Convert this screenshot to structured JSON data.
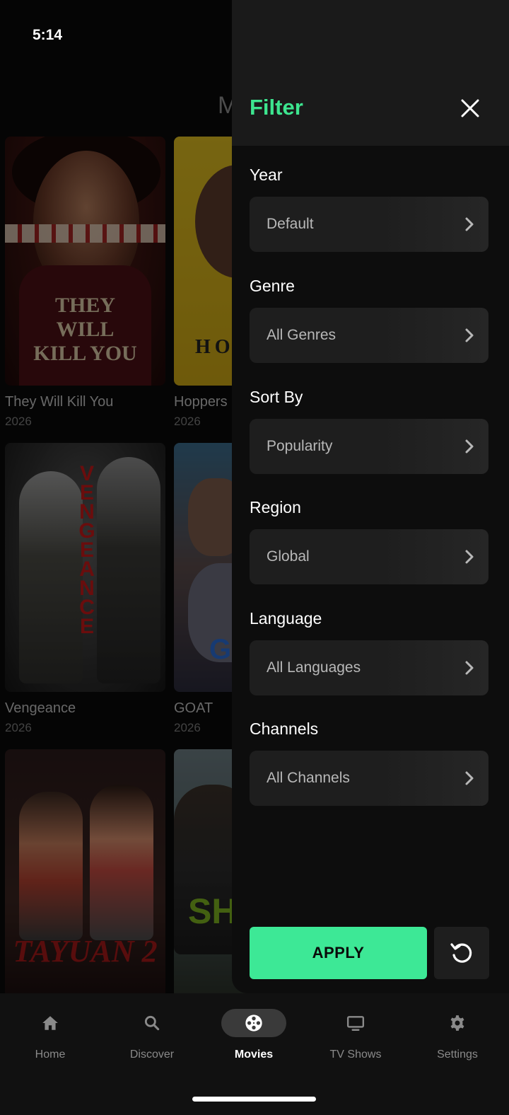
{
  "status_bar": {
    "time": "5:14"
  },
  "page": {
    "title": "M"
  },
  "movies": [
    {
      "title": "They Will Kill You",
      "year": "2026",
      "poster_text": "THEY WILL KILL YOU"
    },
    {
      "title": "Hoppers",
      "year": "2026",
      "poster_text": "HO"
    },
    {
      "title": "Vengeance",
      "year": "2026",
      "poster_text": "VENGEANCE"
    },
    {
      "title": "GOAT",
      "year": "2026",
      "poster_text": "G"
    },
    {
      "title": "",
      "year": "",
      "poster_text": "TAYUAN 2"
    },
    {
      "title": "",
      "year": "",
      "poster_text": "SH"
    }
  ],
  "filter": {
    "title": "Filter",
    "fields": [
      {
        "label": "Year",
        "value": "Default"
      },
      {
        "label": "Genre",
        "value": "All Genres"
      },
      {
        "label": "Sort By",
        "value": "Popularity"
      },
      {
        "label": "Region",
        "value": "Global"
      },
      {
        "label": "Language",
        "value": "All Languages"
      },
      {
        "label": "Channels",
        "value": "All Channels"
      }
    ],
    "apply_label": "APPLY",
    "accent_color": "#3de58f"
  },
  "nav": {
    "items": [
      {
        "label": "Home",
        "icon": "home-icon"
      },
      {
        "label": "Discover",
        "icon": "search-icon"
      },
      {
        "label": "Movies",
        "icon": "film-reel-icon",
        "active": true
      },
      {
        "label": "TV Shows",
        "icon": "tv-icon"
      },
      {
        "label": "Settings",
        "icon": "gear-icon"
      }
    ]
  }
}
